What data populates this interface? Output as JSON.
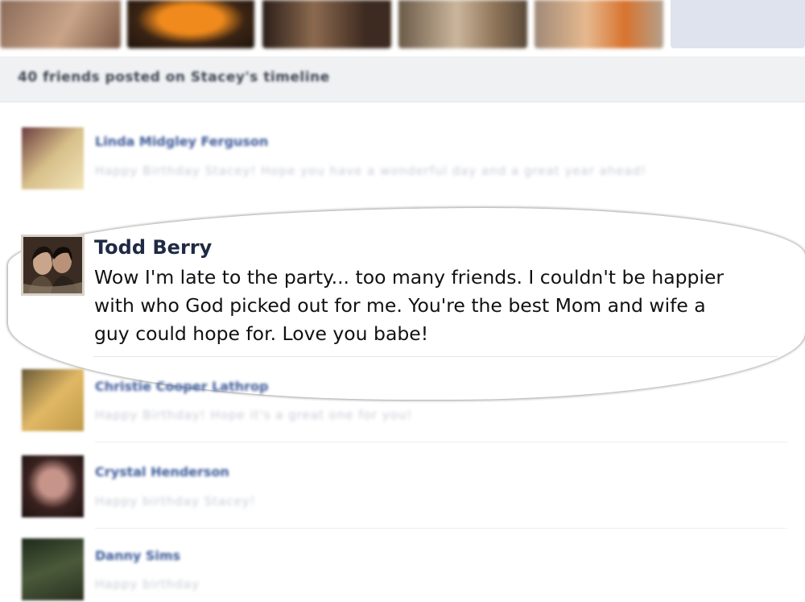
{
  "header": {
    "title": "40 friends posted on Stacey's timeline"
  },
  "posts": [
    {
      "name": "Linda Midgley Ferguson",
      "text": "Happy Birthday Stacey! Hope you have a wonderful day and a great year ahead!"
    },
    {
      "name": "Todd Berry",
      "text_lines": [
        "Wow I'm late to the party... too many friends. I couldn't be happier",
        "with who God picked out for me. You're the best Mom and wife a",
        "guy could hope for. Love you babe!"
      ]
    },
    {
      "name": "Christie Cooper Lathrop",
      "text": "Happy Birthday! Hope it's a great one for you!"
    },
    {
      "name": "Crystal Henderson",
      "text": "Happy birthday Stacey!"
    },
    {
      "name": "Danny Sims",
      "text": "Happy birthday"
    }
  ]
}
